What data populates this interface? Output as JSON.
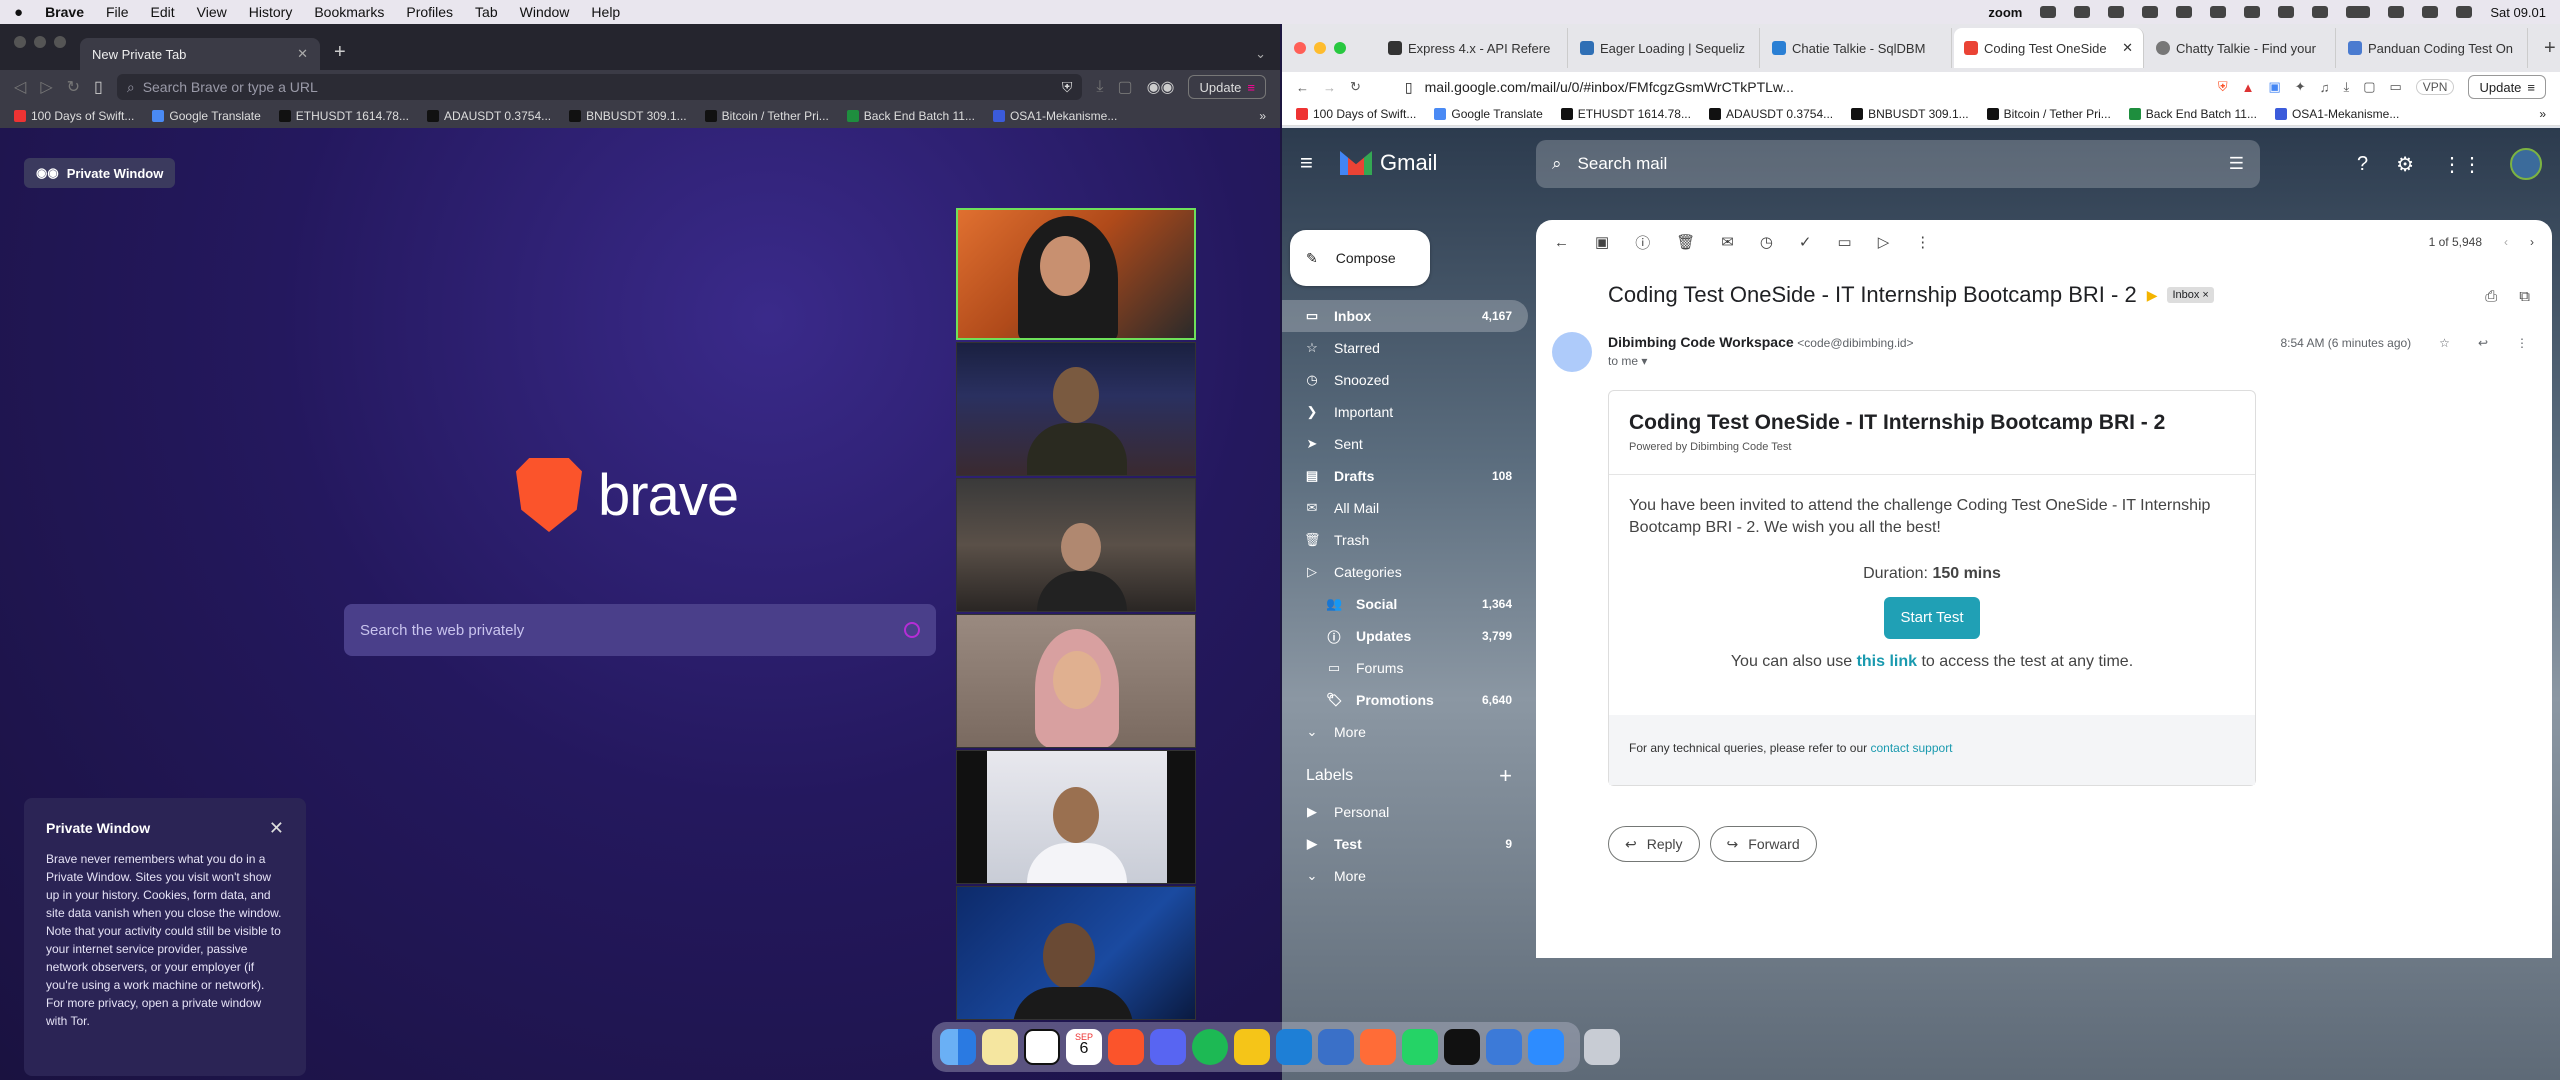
{
  "menubar": {
    "apple": "",
    "items": [
      "Brave",
      "File",
      "Edit",
      "View",
      "History",
      "Bookmarks",
      "Profiles",
      "Tab",
      "Window",
      "Help"
    ],
    "zoom": "zoom",
    "clock": "Sat 09.01"
  },
  "left": {
    "tab_title": "New Private Tab",
    "url_placeholder": "Search Brave or type a URL",
    "update": "Update",
    "bookmarks": [
      "100 Days of Swift...",
      "Google Translate",
      "ETHUSDT 1614.78...",
      "ADAUSDT 0.3754...",
      "BNBUSDT 309.1...",
      "Bitcoin / Tether Pri...",
      "Back End Batch 11...",
      "OSA1-Mekanisme..."
    ],
    "private_badge": "Private Window",
    "logo_text": "brave",
    "search_placeholder": "Search the web privately",
    "card_title": "Private Window",
    "card_body": "Brave never remembers what you do in a Private Window. Sites you visit won't show up in your history. Cookies, form data, and site data vanish when you close the window. Note that your activity could still be visible to your internet service provider, passive network observers, or your employer (if you're using a work machine or network). For more privacy, open a private window with Tor."
  },
  "right": {
    "tabs": [
      "Express 4.x - API Refere",
      "Eager Loading | Sequeliz",
      "Chatie Talkie - SqlDBM",
      "Coding Test OneSide",
      "Chatty Talkie - Find your",
      "Panduan Coding Test On"
    ],
    "active_tab": 3,
    "url": "mail.google.com/mail/u/0/#inbox/FMfcgzGsmWrCTkPTLw...",
    "vpn": "VPN",
    "update": "Update",
    "bookmarks": [
      "100 Days of Swift...",
      "Google Translate",
      "ETHUSDT 1614.78...",
      "ADAUSDT 0.3754...",
      "BNBUSDT 309.1...",
      "Bitcoin / Tether Pri...",
      "Back End Batch 11...",
      "OSA1-Mekanisme..."
    ]
  },
  "gmail": {
    "brand": "Gmail",
    "search_placeholder": "Search mail",
    "compose": "Compose",
    "nav": [
      {
        "label": "Inbox",
        "count": "4,167",
        "icon": "▭",
        "sel": true
      },
      {
        "label": "Starred",
        "count": "",
        "icon": "☆"
      },
      {
        "label": "Snoozed",
        "count": "",
        "icon": "◷"
      },
      {
        "label": "Important",
        "count": "",
        "icon": "❯"
      },
      {
        "label": "Sent",
        "count": "",
        "icon": "➤"
      },
      {
        "label": "Drafts",
        "count": "108",
        "icon": "▤",
        "bold": true
      },
      {
        "label": "All Mail",
        "count": "",
        "icon": "✉"
      },
      {
        "label": "Trash",
        "count": "",
        "icon": "🗑"
      },
      {
        "label": "Categories",
        "count": "",
        "icon": "▷"
      }
    ],
    "categories": [
      {
        "label": "Social",
        "count": "1,364",
        "icon": "👥",
        "bold": true
      },
      {
        "label": "Updates",
        "count": "3,799",
        "icon": "ⓘ",
        "bold": true
      },
      {
        "label": "Forums",
        "count": "",
        "icon": "▭"
      },
      {
        "label": "Promotions",
        "count": "6,640",
        "icon": "🏷",
        "bold": true
      }
    ],
    "more": "More",
    "labels_title": "Labels",
    "labels": [
      {
        "label": "Personal",
        "count": ""
      },
      {
        "label": "Test",
        "count": "9",
        "bold": true
      }
    ],
    "labels_more": "More",
    "pager": "1 of 5,948",
    "subject": "Coding Test OneSide - IT Internship Bootcamp BRI - 2",
    "inbox_tag": "Inbox ×",
    "sender_name": "Dibimbing Code Workspace",
    "sender_email": "<code@dibimbing.id>",
    "to": "to me ▾",
    "time": "8:54 AM (6 minutes ago)",
    "card_title": "Coding Test OneSide - IT Internship Bootcamp BRI - 2",
    "card_powered": "Powered by Dibimbing Code Test",
    "card_intro": "You have been invited to attend the challenge Coding Test OneSide - IT Internship Bootcamp BRI - 2. We wish you all the best!",
    "duration_label": "Duration:",
    "duration_value": "150 mins",
    "start_btn": "Start Test",
    "also_pre": "You can also use",
    "also_link": "this link",
    "also_post": "to access the test at any time.",
    "foot_pre": "For any technical queries, please refer to our",
    "foot_link": "contact support",
    "reply": "Reply",
    "forward": "Forward"
  },
  "dock": {
    "calendar_month": "SEP",
    "calendar_day": "6"
  },
  "colors": {
    "brave_orange": "#fb542b",
    "start_button": "#20a0b5",
    "speaker_highlight": "#6ee05a"
  }
}
